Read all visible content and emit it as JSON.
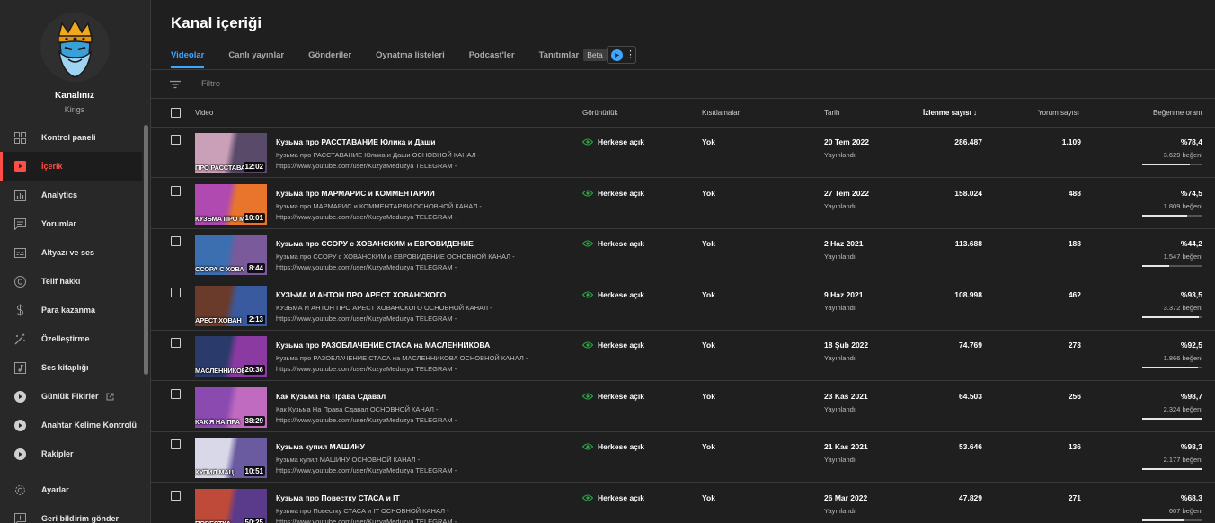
{
  "sidebar": {
    "channel_label": "Kanalınız",
    "channel_name": "Kings",
    "items": [
      {
        "label": "Kontrol paneli",
        "icon": "dashboard-icon",
        "active": false
      },
      {
        "label": "İçerik",
        "icon": "content-icon",
        "active": true
      },
      {
        "label": "Analytics",
        "icon": "analytics-icon",
        "active": false
      },
      {
        "label": "Yorumlar",
        "icon": "comments-icon",
        "active": false
      },
      {
        "label": "Altyazı ve ses",
        "icon": "subtitles-icon",
        "active": false
      },
      {
        "label": "Telif hakkı",
        "icon": "copyright-icon",
        "active": false
      },
      {
        "label": "Para kazanma",
        "icon": "dollar-icon",
        "active": false
      },
      {
        "label": "Özelleştirme",
        "icon": "magic-wand-icon",
        "active": false
      },
      {
        "label": "Ses kitaplığı",
        "icon": "audio-library-icon",
        "active": false
      },
      {
        "label": "Günlük Fikirler",
        "icon": "play-circle-icon",
        "active": false,
        "external": true
      },
      {
        "label": "Anahtar Kelime Kontrolü",
        "icon": "play-circle-icon",
        "active": false
      },
      {
        "label": "Rakipler",
        "icon": "play-circle-icon",
        "active": false
      }
    ],
    "bottom_items": [
      {
        "label": "Ayarlar",
        "icon": "gear-icon"
      },
      {
        "label": "Geri bildirim gönder",
        "icon": "feedback-icon"
      }
    ]
  },
  "header": {
    "title": "Kanal içeriği",
    "tabs": [
      {
        "label": "Videolar",
        "active": true
      },
      {
        "label": "Canlı yayınlar",
        "active": false
      },
      {
        "label": "Gönderiler",
        "active": false
      },
      {
        "label": "Oynatma listeleri",
        "active": false
      },
      {
        "label": "Podcast'ler",
        "active": false
      },
      {
        "label": "Tanıtımlar",
        "active": false,
        "badge": "Beta"
      }
    ]
  },
  "filter": {
    "placeholder": "Filtre"
  },
  "table": {
    "columns": {
      "video": "Video",
      "visibility": "Görünürlük",
      "restrictions": "Kısıtlamalar",
      "date": "Tarih",
      "views": "İzlenme sayısı",
      "comments": "Yorum sayısı",
      "likes": "Beğenme oranı"
    },
    "rows": [
      {
        "title": "Кузьма про РАССТАВАНИЕ Юлика и Даши",
        "desc1": "Кузьма про РАССТАВАНИЕ Юлика и Даши ОСНОВНОЙ КАНАЛ -",
        "desc2": "https://www.youtube.com/user/KuzyaMeduzya TELEGRAM -",
        "duration": "12:02",
        "caption": "ПРО РАССТАВАНИ",
        "visibility": "Herkese açık",
        "restriction": "Yok",
        "date": "20 Tem 2022",
        "date_status": "Yayınlandı",
        "views": "286.487",
        "comments": "1.109",
        "like_pct": "%78,4",
        "like_count": "3.629 beğeni",
        "like_ratio": 0.784,
        "thumb_colors": [
          "#c9a0b8",
          "#5a4a6a"
        ]
      },
      {
        "title": "Кузьма про МАРМАРИС и КОММЕНТАРИИ",
        "desc1": "Кузьма про МАРМАРИС и КОММЕНТАРИИ ОСНОВНОЙ КАНАЛ -",
        "desc2": "https://www.youtube.com/user/KuzyaMeduzya TELEGRAM -",
        "duration": "10:01",
        "caption": "КУЗЬМА ПРО МАРМ",
        "visibility": "Herkese açık",
        "restriction": "Yok",
        "date": "27 Tem 2022",
        "date_status": "Yayınlandı",
        "views": "158.024",
        "comments": "488",
        "like_pct": "%74,5",
        "like_count": "1.809 beğeni",
        "like_ratio": 0.745,
        "thumb_colors": [
          "#b04ab0",
          "#e8752b"
        ]
      },
      {
        "title": "Кузьма про ССОРУ с ХОВАНСКИМ и ЕВРОВИДЕНИЕ",
        "desc1": "Кузьма про ССОРУ с ХОВАНСКИМ и ЕВРОВИДЕНИЕ ОСНОВНОЙ КАНАЛ -",
        "desc2": "https://www.youtube.com/user/KuzyaMeduzya TELEGRAM -",
        "duration": "8:44",
        "caption": "ССОРА С ХОВА",
        "visibility": "Herkese açık",
        "restriction": "Yok",
        "date": "2 Haz 2021",
        "date_status": "Yayınlandı",
        "views": "113.688",
        "comments": "188",
        "like_pct": "%44,2",
        "like_count": "1.547 beğeni",
        "like_ratio": 0.442,
        "thumb_colors": [
          "#3b6fb0",
          "#7a5a9a"
        ]
      },
      {
        "title": "КУЗЬМА И АНТОН ПРО АРЕСТ ХОВАНСКОГО",
        "desc1": "КУЗЬМА И АНТОН ПРО АРЕСТ ХОВАНСКОГО ОСНОВНОЙ КАНАЛ -",
        "desc2": "https://www.youtube.com/user/KuzyaMeduzya TELEGRAM -",
        "duration": "2:13",
        "caption": "АРЕСТ ХОВАН",
        "visibility": "Herkese açık",
        "restriction": "Yok",
        "date": "9 Haz 2021",
        "date_status": "Yayınlandı",
        "views": "108.998",
        "comments": "462",
        "like_pct": "%93,5",
        "like_count": "3.372 beğeni",
        "like_ratio": 0.935,
        "thumb_colors": [
          "#6a3a2a",
          "#3a5aa0"
        ]
      },
      {
        "title": "Кузьма про РАЗОБЛАЧЕНИЕ СТАСА на МАСЛЕННИКОВА",
        "desc1": "Кузьма про РАЗОБЛАЧЕНИЕ СТАСА на МАСЛЕННИКОВА ОСНОВНОЙ КАНАЛ -",
        "desc2": "https://www.youtube.com/user/KuzyaMeduzya TELEGRAM -",
        "duration": "20:36",
        "caption": "МАСЛЕННИКОВА",
        "visibility": "Herkese açık",
        "restriction": "Yok",
        "date": "18 Şub 2022",
        "date_status": "Yayınlandı",
        "views": "74.769",
        "comments": "273",
        "like_pct": "%92,5",
        "like_count": "1.866 beğeni",
        "like_ratio": 0.925,
        "thumb_colors": [
          "#2a3a6a",
          "#8a3aa0"
        ]
      },
      {
        "title": "Как Кузьма На Права Сдавал",
        "desc1": "Как Кузьма На Права Сдавал ОСНОВНОЙ КАНАЛ -",
        "desc2": "https://www.youtube.com/user/KuzyaMeduzya TELEGRAM -",
        "duration": "38:29",
        "caption": "КАК Я НА ПРА",
        "visibility": "Herkese açık",
        "restriction": "Yok",
        "date": "23 Kas 2021",
        "date_status": "Yayınlandı",
        "views": "64.503",
        "comments": "256",
        "like_pct": "%98,7",
        "like_count": "2.324 beğeni",
        "like_ratio": 0.987,
        "thumb_colors": [
          "#8a4ab0",
          "#c06ac0"
        ]
      },
      {
        "title": "Кузьма купил МАШИНУ",
        "desc1": "Кузьма купил МАШИНУ ОСНОВНОЙ КАНАЛ -",
        "desc2": "https://www.youtube.com/user/KuzyaMeduzya TELEGRAM -",
        "duration": "10:51",
        "caption": "КУПИЛ МАЦ",
        "visibility": "Herkese açık",
        "restriction": "Yok",
        "date": "21 Kas 2021",
        "date_status": "Yayınlandı",
        "views": "53.646",
        "comments": "136",
        "like_pct": "%98,3",
        "like_count": "2.177 beğeni",
        "like_ratio": 0.983,
        "thumb_colors": [
          "#d8d8e8",
          "#6a5aa0"
        ]
      },
      {
        "title": "Кузьма про Повестку СТАСА и IT",
        "desc1": "Кузьма про Повестку СТАСА и IT ОСНОВНОЙ КАНАЛ -",
        "desc2": "https://www.youtube.com/user/KuzyaMeduzya TELEGRAM -",
        "duration": "50:25",
        "caption": "ПОВЕСТКА",
        "visibility": "Herkese açık",
        "restriction": "Yok",
        "date": "26 Mar 2022",
        "date_status": "Yayınlandı",
        "views": "47.829",
        "comments": "271",
        "like_pct": "%68,3",
        "like_count": "607 beğeni",
        "like_ratio": 0.683,
        "thumb_colors": [
          "#c04a3a",
          "#5a3a8a"
        ]
      }
    ]
  }
}
